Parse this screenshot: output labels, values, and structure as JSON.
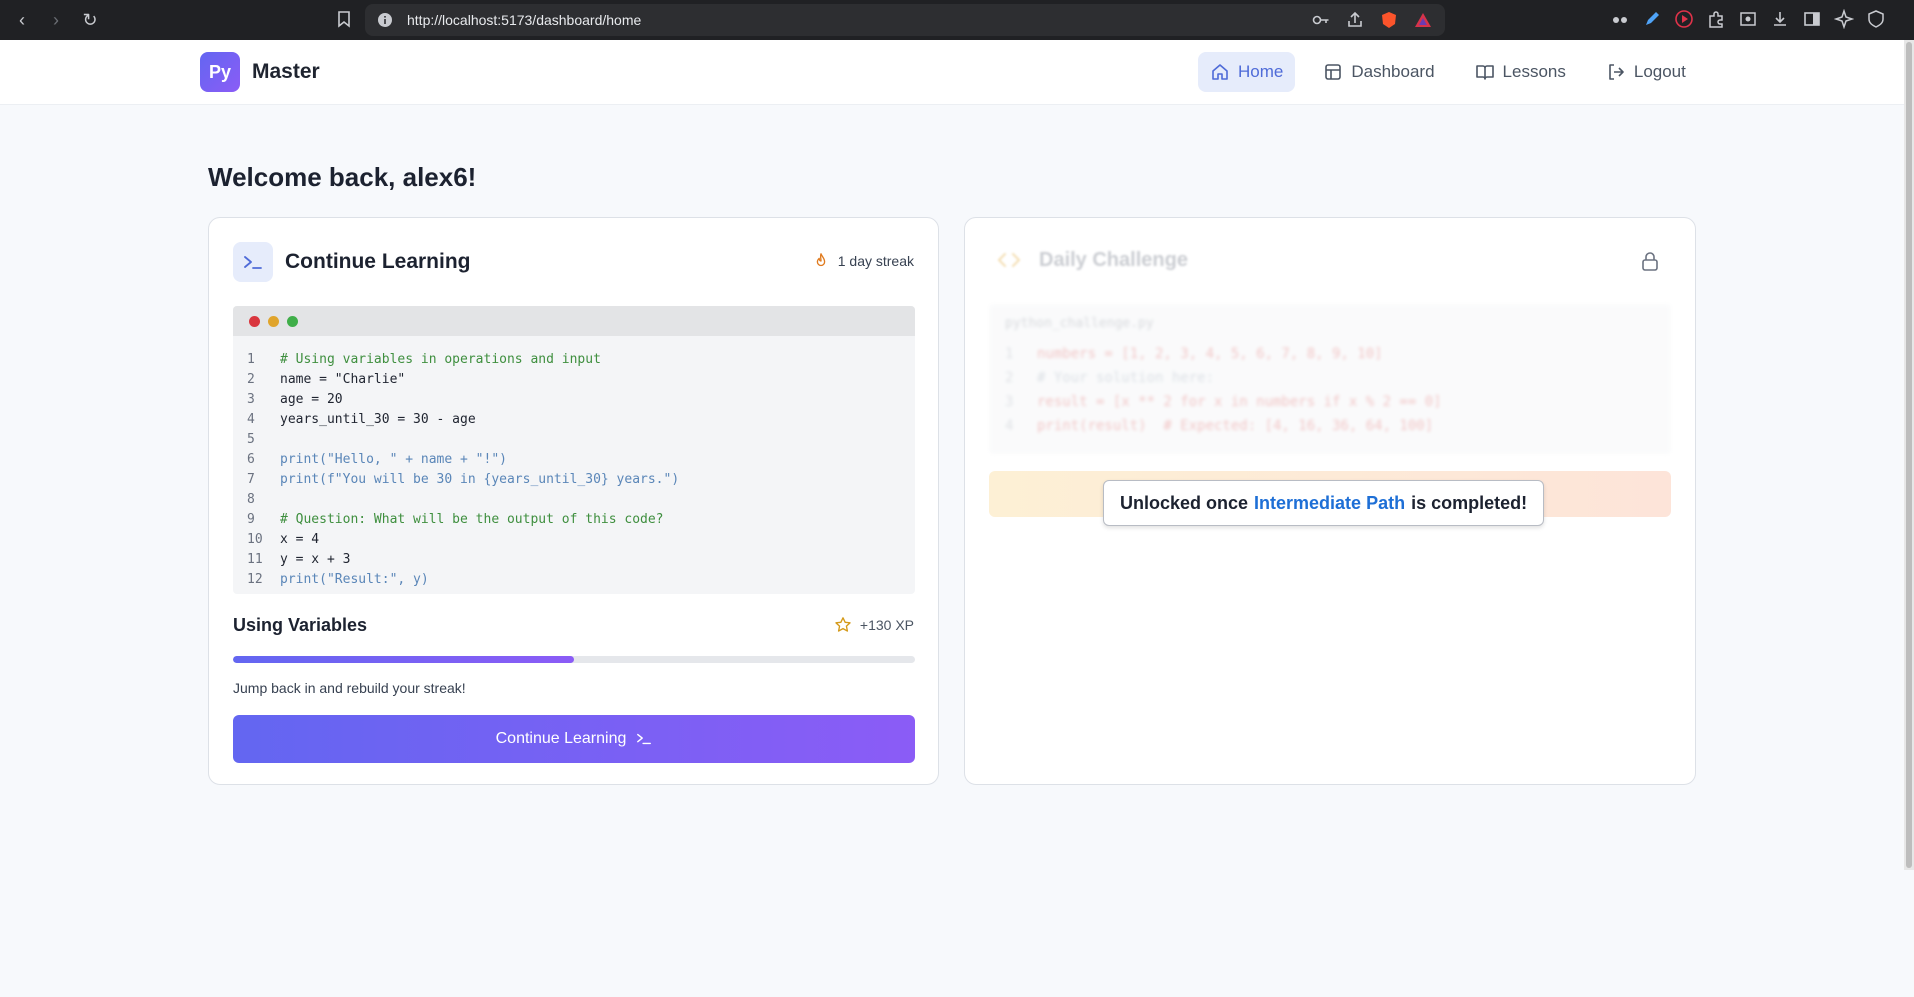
{
  "browser": {
    "url": "http://localhost:5173/dashboard/home"
  },
  "header": {
    "logo_badge": "Py",
    "logo_text": "Master",
    "nav": [
      {
        "label": "Home",
        "icon": "home-icon",
        "active": true
      },
      {
        "label": "Dashboard",
        "icon": "dashboard-icon",
        "active": false
      },
      {
        "label": "Lessons",
        "icon": "book-icon",
        "active": false
      },
      {
        "label": "Logout",
        "icon": "logout-icon",
        "active": false
      }
    ]
  },
  "welcome": "Welcome back, alex6!",
  "continue_card": {
    "title": "Continue Learning",
    "streak": "1 day streak",
    "code_lines": [
      {
        "n": "1",
        "text": "# Using variables in operations and input",
        "kind": "comment"
      },
      {
        "n": "2",
        "text": "name = \"Charlie\"",
        "kind": "plain"
      },
      {
        "n": "3",
        "text": "age = 20",
        "kind": "plain"
      },
      {
        "n": "4",
        "text": "years_until_30 = 30 - age",
        "kind": "plain"
      },
      {
        "n": "5",
        "text": "",
        "kind": "plain"
      },
      {
        "n": "6",
        "text": "print(\"Hello, \" + name + \"!\")",
        "kind": "print"
      },
      {
        "n": "7",
        "text": "print(f\"You will be 30 in {years_until_30} years.\")",
        "kind": "print"
      },
      {
        "n": "8",
        "text": "",
        "kind": "plain"
      },
      {
        "n": "9",
        "text": "# Question: What will be the output of this code?",
        "kind": "comment"
      },
      {
        "n": "10",
        "text": "x = 4",
        "kind": "plain"
      },
      {
        "n": "11",
        "text": "y = x + 3",
        "kind": "plain"
      },
      {
        "n": "12",
        "text": "print(\"Result:\", y)",
        "kind": "print"
      }
    ],
    "lesson_name": "Using Variables",
    "xp": "+130 XP",
    "progress_fraction": 0.5,
    "hint": "Jump back in and rebuild your streak!",
    "cta_label": "Continue Learning"
  },
  "challenge_card": {
    "title": "Daily Challenge",
    "file_name": "python_challenge.py",
    "code_lines": [
      {
        "n": "1",
        "text": "numbers = [1, 2, 3, 4, 5, 6, 7, 8, 9, 10]",
        "kind": "plain"
      },
      {
        "n": "2",
        "text": "# Your solution here:",
        "kind": "comment"
      },
      {
        "n": "3",
        "text": "result = [x ** 2 for x in numbers if x % 2 == 0]",
        "kind": "plain"
      },
      {
        "n": "4",
        "text": "print(result)  # Expected: [4, 16, 36, 64, 100]",
        "kind": "plain"
      }
    ],
    "unlock_prefix": "Unlocked once",
    "unlock_link": "Intermediate Path",
    "unlock_suffix": "is completed!"
  },
  "colors": {
    "accent": "#6366f1",
    "accent2": "#8b5cf6",
    "nav_active_bg": "#e6ecfb",
    "link": "#1e6fd6"
  }
}
